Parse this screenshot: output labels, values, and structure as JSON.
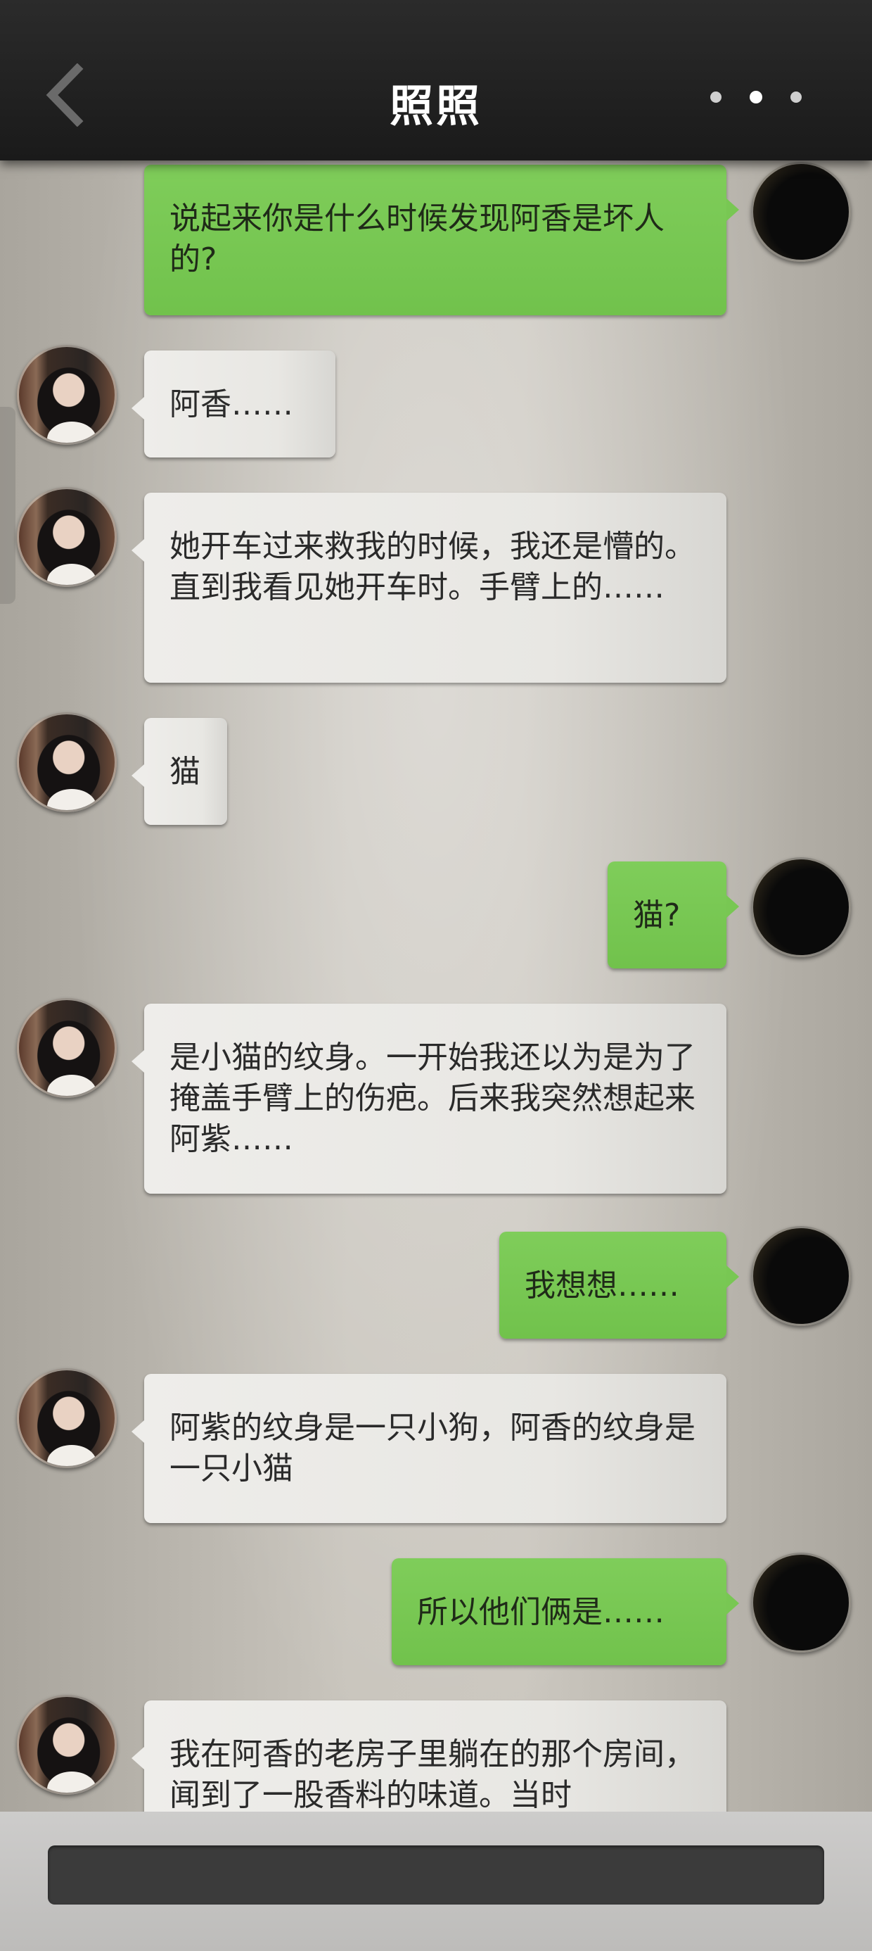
{
  "header": {
    "title": "照照",
    "back_icon": "chevron-left-icon",
    "more_icon": "more-dots-icon"
  },
  "messages": [
    {
      "side": "right",
      "text": "说起来你是什么时候发现阿香是坏人的?"
    },
    {
      "side": "left",
      "text": "阿香……"
    },
    {
      "side": "left",
      "text": "她开车过来救我的时候，我还是懵的。直到我看见她开车时。手臂上的……"
    },
    {
      "side": "left",
      "text": "猫"
    },
    {
      "side": "right",
      "text": "猫?"
    },
    {
      "side": "left",
      "text": "是小猫的纹身。一开始我还以为是为了掩盖手臂上的伤疤。后来我突然想起来阿紫……"
    },
    {
      "side": "right",
      "text": "我想想……"
    },
    {
      "side": "left",
      "text": "阿紫的纹身是一只小狗，阿香的纹身是一只小猫"
    },
    {
      "side": "right",
      "text": "所以他们俩是……"
    },
    {
      "side": "left",
      "text": "我在阿香的老房子里躺在的那个房间，闻到了一股香料的味道。当时"
    }
  ],
  "colors": {
    "top_bar": "#1f1f1f",
    "bubble_self": "#78c753",
    "bubble_other": "#ebeae6",
    "input_bar": "#3b3b3b"
  }
}
